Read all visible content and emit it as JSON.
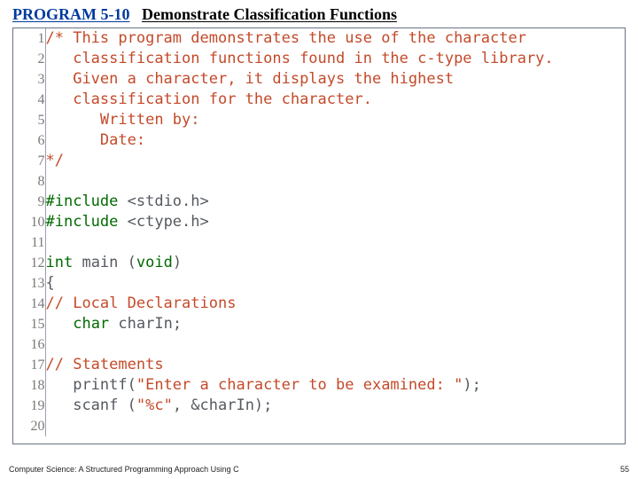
{
  "title": {
    "program_label": "PROGRAM 5-10",
    "program_title": "Demonstrate Classification Functions"
  },
  "code": {
    "lines": [
      {
        "n": "1",
        "cls": "c-comment",
        "text": "/* This program demonstrates the use of the character"
      },
      {
        "n": "2",
        "cls": "c-comment",
        "text": "   classification functions found in the c-type library."
      },
      {
        "n": "3",
        "cls": "c-comment",
        "text": "   Given a character, it displays the highest"
      },
      {
        "n": "4",
        "cls": "c-comment",
        "text": "   classification for the character."
      },
      {
        "n": "5",
        "cls": "c-comment",
        "text": "      Written by:"
      },
      {
        "n": "6",
        "cls": "c-comment",
        "text": "      Date:"
      },
      {
        "n": "7",
        "cls": "c-comment",
        "text": "*/"
      },
      {
        "n": "8",
        "cls": "c-text",
        "text": ""
      },
      {
        "n": "9",
        "cls": "mixed",
        "segments": [
          {
            "cls": "c-keyword",
            "t": "#include"
          },
          {
            "cls": "c-text",
            "t": " <stdio.h>"
          }
        ]
      },
      {
        "n": "10",
        "cls": "mixed",
        "segments": [
          {
            "cls": "c-keyword",
            "t": "#include"
          },
          {
            "cls": "c-text",
            "t": " <ctype.h>"
          }
        ]
      },
      {
        "n": "11",
        "cls": "c-text",
        "text": ""
      },
      {
        "n": "12",
        "cls": "mixed",
        "segments": [
          {
            "cls": "c-keyword",
            "t": "int"
          },
          {
            "cls": "c-text",
            "t": " main ("
          },
          {
            "cls": "c-keyword",
            "t": "void"
          },
          {
            "cls": "c-text",
            "t": ")"
          }
        ]
      },
      {
        "n": "13",
        "cls": "c-text",
        "text": "{"
      },
      {
        "n": "14",
        "cls": "c-comment",
        "text": "// Local Declarations"
      },
      {
        "n": "15",
        "cls": "mixed",
        "segments": [
          {
            "cls": "c-text",
            "t": "   "
          },
          {
            "cls": "c-keyword",
            "t": "char"
          },
          {
            "cls": "c-text",
            "t": " charIn;"
          }
        ]
      },
      {
        "n": "16",
        "cls": "c-text",
        "text": ""
      },
      {
        "n": "17",
        "cls": "c-comment",
        "text": "// Statements"
      },
      {
        "n": "18",
        "cls": "mixed",
        "segments": [
          {
            "cls": "c-text",
            "t": "   printf("
          },
          {
            "cls": "c-string",
            "t": "\"Enter a character to be examined: \""
          },
          {
            "cls": "c-text",
            "t": ");"
          }
        ]
      },
      {
        "n": "19",
        "cls": "mixed",
        "segments": [
          {
            "cls": "c-text",
            "t": "   scanf ("
          },
          {
            "cls": "c-string",
            "t": "\"%c\""
          },
          {
            "cls": "c-text",
            "t": ", &charIn);"
          }
        ]
      },
      {
        "n": "20",
        "cls": "c-text",
        "text": ""
      }
    ]
  },
  "footer": {
    "left": "Computer Science: A Structured Programming Approach Using C",
    "right": "55"
  }
}
